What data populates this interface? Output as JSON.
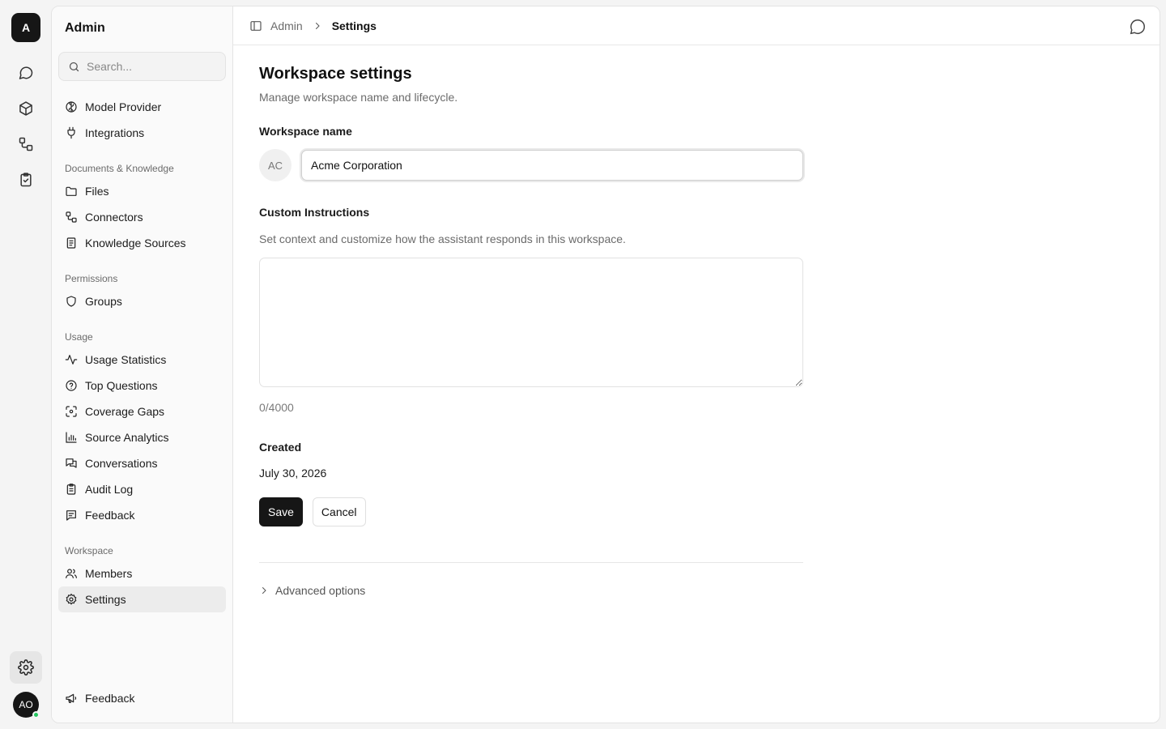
{
  "rail": {
    "logo": "A",
    "icons": [
      "chat-icon",
      "cube-icon",
      "workflow-icon",
      "clipboard-check-icon"
    ],
    "user_initials": "AO",
    "status_color": "#22c55e"
  },
  "sidebar": {
    "title": "Admin",
    "search_placeholder": "Search...",
    "top_items": [
      {
        "label": "Model Provider",
        "icon": "brain-icon"
      },
      {
        "label": "Integrations",
        "icon": "plug-icon"
      }
    ],
    "groups": [
      {
        "label": "Documents & Knowledge",
        "items": [
          "Files",
          "Connectors",
          "Knowledge Sources"
        ]
      },
      {
        "label": "Permissions",
        "items": [
          "Groups"
        ]
      },
      {
        "label": "Usage",
        "items": [
          "Usage Statistics",
          "Top Questions",
          "Coverage Gaps",
          "Source Analytics",
          "Conversations",
          "Audit Log",
          "Feedback"
        ]
      },
      {
        "label": "Workspace",
        "items": [
          "Members",
          "Settings"
        ]
      }
    ],
    "active_item": "Settings",
    "footer_label": "Feedback"
  },
  "breadcrumb": {
    "parent": "Admin",
    "current": "Settings"
  },
  "page": {
    "title": "Workspace settings",
    "subtitle": "Manage workspace name and lifecycle.",
    "name_label": "Workspace name",
    "workspace_initials": "AC",
    "name_value": "Acme Corporation",
    "instructions_label": "Custom Instructions",
    "instructions_help": "Set context and customize how the assistant responds in this workspace.",
    "instructions_value": "",
    "counter": "0/4000",
    "created_label": "Created",
    "created_value": "July 30, 2026",
    "save_label": "Save",
    "cancel_label": "Cancel",
    "advanced_label": "Advanced options"
  }
}
